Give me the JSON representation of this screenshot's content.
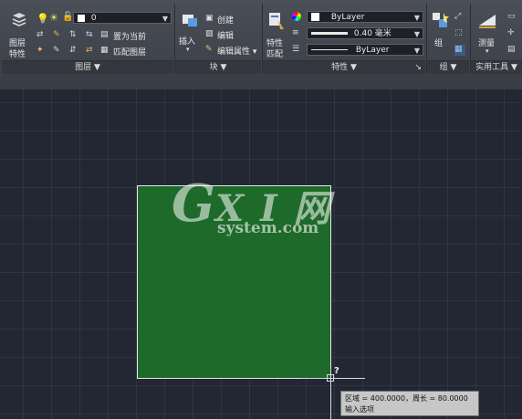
{
  "ribbon": {
    "layers": {
      "properties_label_1": "图层",
      "properties_label_2": "特性",
      "layer_value": "0",
      "set_current": "置为当前",
      "match_layer": "匹配图层",
      "panel_title": "图层 ▼"
    },
    "block": {
      "insert": "插入",
      "create": "创建",
      "edit": "编辑",
      "edit_attr": "编辑属性 ▾",
      "panel_title": "块 ▼"
    },
    "properties": {
      "match_label_1": "特性",
      "match_label_2": "匹配",
      "color_value": "ByLayer",
      "lineweight_value": "0.40 毫米",
      "linetype_value": "ByLayer",
      "panel_title": "特性 ▼",
      "panel_corner": "↘"
    },
    "groups": {
      "group": "组",
      "panel_title": "组 ▼"
    },
    "utilities": {
      "measure": "测量",
      "panel_title": "实用工具 ▼"
    }
  },
  "canvas": {
    "cursor_hint": "?",
    "tooltip_line1": "区域 = 400.0000，周长 = 80.0000",
    "tooltip_line2": "输入选项",
    "rect_color": "#1e6a2a"
  },
  "watermark": {
    "g": "G",
    "xi": "X I 网",
    "sub": "system.com"
  }
}
